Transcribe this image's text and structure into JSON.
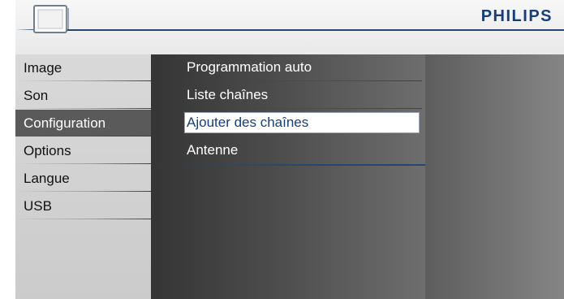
{
  "header": {
    "brand": "PHILIPS",
    "icon": "tv-icon"
  },
  "main_menu": {
    "items": [
      {
        "label": "Image"
      },
      {
        "label": "Son"
      },
      {
        "label": "Configuration",
        "selected": true
      },
      {
        "label": "Options"
      },
      {
        "label": "Langue"
      },
      {
        "label": "USB"
      }
    ]
  },
  "sub_menu": {
    "items": [
      {
        "label": "Programmation auto"
      },
      {
        "label": "Liste chaînes"
      },
      {
        "label": "Ajouter des chaînes",
        "highlighted": true
      },
      {
        "label": "Antenne"
      }
    ]
  },
  "colors": {
    "brand": "#173e7c",
    "accent_line": "#23476f",
    "selected_bg": "#5a5a5a"
  }
}
